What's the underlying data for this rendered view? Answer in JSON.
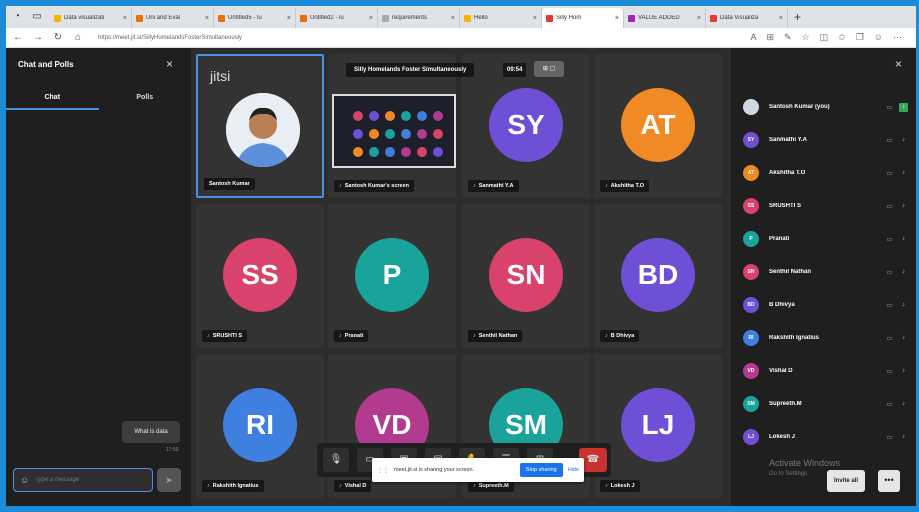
{
  "browser": {
    "tabs": [
      {
        "label": "Data visualizati",
        "color": "#f4b400"
      },
      {
        "label": "Uni and Eval",
        "color": "#e8710a"
      },
      {
        "label": "Untitled5 - lu",
        "color": "#e8710a"
      },
      {
        "label": "Untitled2 - lu",
        "color": "#e8710a"
      },
      {
        "label": "requirements",
        "color": "#aaaaaa"
      },
      {
        "label": "Hello",
        "color": "#f4b400"
      },
      {
        "label": "Silly Hom",
        "color": "#e53935",
        "active": true
      },
      {
        "label": "VALUE ADDED",
        "color": "#9c27b0"
      },
      {
        "label": "Data Visualiza",
        "color": "#e53935"
      }
    ],
    "new_tab": "+",
    "url": "https://meet.jit.si/SillyHomelandsFosterSimultaneously"
  },
  "chat": {
    "title": "Chat and Polls",
    "close": "×",
    "tabs": [
      "Chat",
      "Polls"
    ],
    "message": "What is data",
    "time": "17:59",
    "placeholder": "Type a message",
    "emoji": "☺",
    "send": "➤"
  },
  "meeting": {
    "logo": "jitsi",
    "title": "Silly Homelands Foster Simultaneously",
    "timer": "09:54",
    "tiles": [
      {
        "name": "Santosh Kumar",
        "type": "photo"
      },
      {
        "name": "Santosh Kumar's screen",
        "type": "screen"
      },
      {
        "name": "Sanmathi Y.A",
        "initials": "SY",
        "color": "#6e4fd6"
      },
      {
        "name": "Akshitha T.O",
        "initials": "AT",
        "color": "#f08a24"
      },
      {
        "name": "SRUSHTI S",
        "initials": "SS",
        "color": "#d9426b"
      },
      {
        "name": "Pranati",
        "initials": "P",
        "color": "#1aa39a"
      },
      {
        "name": "Senthil Nathan",
        "initials": "SN",
        "color": "#d9426b"
      },
      {
        "name": "B Dhivya",
        "initials": "BD",
        "color": "#6e4fd6"
      },
      {
        "name": "Rakshith Ignatius",
        "initials": "RI",
        "color": "#3f7fe0"
      },
      {
        "name": "Vishal D",
        "initials": "VD",
        "color": "#b23a8f"
      },
      {
        "name": "Supreeth.M",
        "initials": "SM",
        "color": "#1aa39a"
      },
      {
        "name": "Lokesh J",
        "initials": "LJ",
        "color": "#6e4fd6"
      }
    ]
  },
  "share": {
    "text": "meet.jit.si is sharing your screen.",
    "stop": "Stop sharing",
    "hide": "Hide"
  },
  "participants": {
    "close": "×",
    "list": [
      {
        "name": "Santosh Kumar (you)",
        "initials": "",
        "color": "#cfd8e3",
        "you": true
      },
      {
        "name": "Sanmathi Y.A",
        "initials": "SY",
        "color": "#6e4fd6"
      },
      {
        "name": "Akshitha T.O",
        "initials": "AT",
        "color": "#f08a24"
      },
      {
        "name": "SRUSHTI S",
        "initials": "SS",
        "color": "#d9426b"
      },
      {
        "name": "Pranati",
        "initials": "P",
        "color": "#1aa39a"
      },
      {
        "name": "Senthil Nathan",
        "initials": "SN",
        "color": "#d9426b"
      },
      {
        "name": "B Dhivya",
        "initials": "BD",
        "color": "#6e4fd6"
      },
      {
        "name": "Rakshith Ignatius",
        "initials": "RI",
        "color": "#3f7fe0"
      },
      {
        "name": "Vishal D",
        "initials": "VD",
        "color": "#b23a8f"
      },
      {
        "name": "Supreeth.M",
        "initials": "SM",
        "color": "#1aa39a"
      },
      {
        "name": "Lokesh J",
        "initials": "LJ",
        "color": "#6e4fd6"
      }
    ],
    "watermark_line1": "Activate Windows",
    "watermark_line2": "Go to Settings",
    "invite": "Invite all",
    "more": "•••"
  }
}
